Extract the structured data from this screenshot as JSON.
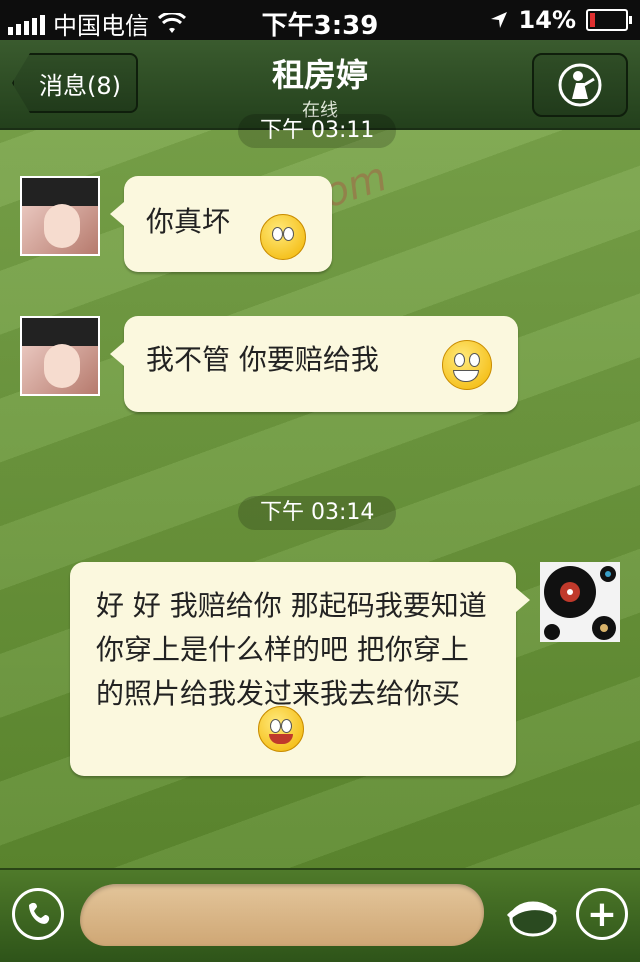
{
  "status_bar": {
    "carrier": "中国电信",
    "time": "下午3:39",
    "battery_percent": "14%",
    "battery_level": 0.14
  },
  "nav": {
    "back_label": "消息(8)",
    "title": "租房婷",
    "subtitle": "在线",
    "profile_icon": "golfer-icon"
  },
  "chat": {
    "timestamps": [
      "下午 03:11",
      "下午 03:14"
    ],
    "messages": [
      {
        "from": "contact",
        "text": "你真坏",
        "emoji": "smile-emoji"
      },
      {
        "from": "contact",
        "text": "我不管  你要赔给我",
        "emoji": "grin-emoji"
      },
      {
        "from": "me",
        "text": "好  好  我赔给你  那起码我要知道你穿上是什么样的吧  把你穿上的照片给我发过来我去给你买",
        "emoji": "smile-emoji"
      }
    ],
    "watermark": "52vwei.com"
  },
  "bottom": {
    "voice_icon": "voice-icon",
    "emoticon_icon": "cap-icon",
    "plus_icon": "plus-icon"
  },
  "colors": {
    "bubble": "#fbf8de",
    "nav": "#2f4d26",
    "grass": "#6f9a3c"
  }
}
